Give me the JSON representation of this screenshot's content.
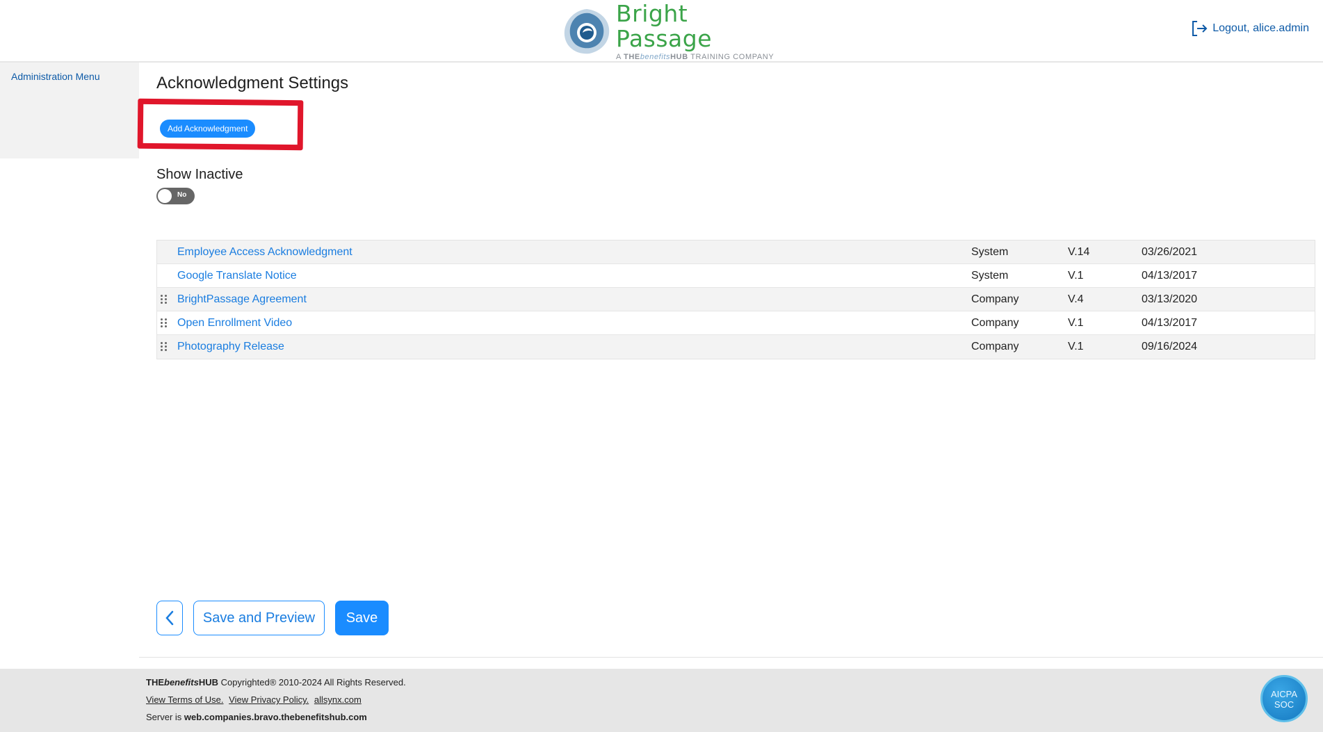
{
  "header": {
    "brand_name": "Bright Passage",
    "tagline_prefix": "A ",
    "tagline_the": "THE",
    "tagline_benefits": "benefits",
    "tagline_hub": "HUB",
    "tagline_suffix": " TRAINING COMPANY",
    "logout_label": "Logout, alice.admin"
  },
  "sidebar": {
    "menu_label": "Administration Menu"
  },
  "main": {
    "title": "Acknowledgment Settings",
    "add_button_label": "Add Acknowledgment",
    "show_inactive_label": "Show Inactive",
    "toggle_value": "No"
  },
  "acknowledgments": [
    {
      "name": "Employee Access Acknowledgment",
      "type": "System",
      "version": "V.14",
      "date": "03/26/2021"
    },
    {
      "name": "Google Translate Notice",
      "type": "System",
      "version": "V.1",
      "date": "04/13/2017"
    },
    {
      "name": "BrightPassage Agreement",
      "type": "Company",
      "version": "V.4",
      "date": "03/13/2020"
    },
    {
      "name": "Open Enrollment Video",
      "type": "Company",
      "version": "V.1",
      "date": "04/13/2017"
    },
    {
      "name": "Photography Release",
      "type": "Company",
      "version": "V.1",
      "date": "09/16/2024"
    }
  ],
  "actions": {
    "save_preview_label": "Save and Preview",
    "save_label": "Save"
  },
  "footer": {
    "brand_the": "THE",
    "brand_benefits": "benefits",
    "brand_hub": "HUB",
    "copyright": " Copyrighted® 2010-2024 All Rights Reserved.",
    "terms_link": "View Terms of Use.",
    "privacy_link": "View Privacy Policy.",
    "site_link": "allsynx.com",
    "server_prefix": "Server is ",
    "server_host": "web.companies.bravo.thebenefitshub.com",
    "badge_line1": "AICPA",
    "badge_line2": "SOC"
  },
  "colors": {
    "accent": "#1a8cff",
    "link": "#1a7de0",
    "brand_green": "#3ba449",
    "highlight_red": "#e0162b"
  }
}
